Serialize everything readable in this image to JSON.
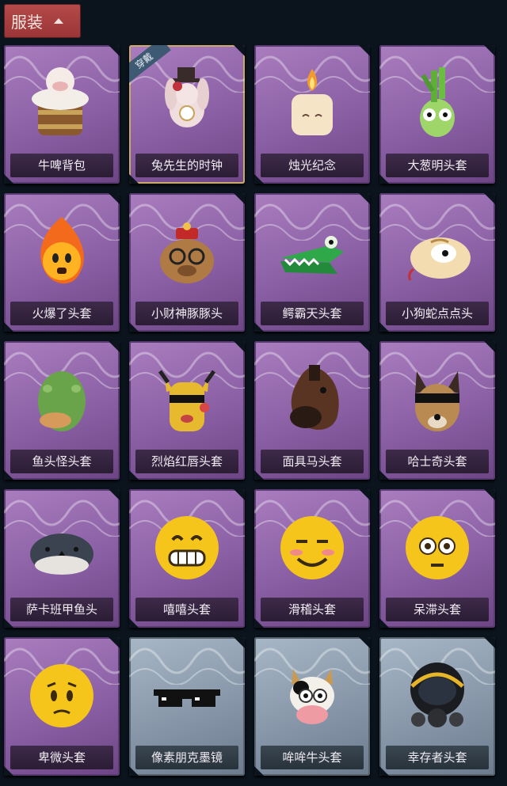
{
  "header": {
    "title": "服装"
  },
  "badge_text": "穿戴",
  "items": [
    {
      "label": "牛啤背包",
      "icon": "beer-barrel-backpack-icon",
      "theme": "purple"
    },
    {
      "label": "兔先生的时钟",
      "icon": "rabbit-clock-icon",
      "theme": "purple",
      "equipped": true
    },
    {
      "label": "烛光纪念",
      "icon": "candle-icon",
      "theme": "purple"
    },
    {
      "label": "大葱明头套",
      "icon": "scallion-head-icon",
      "theme": "purple"
    },
    {
      "label": "火爆了头套",
      "icon": "fire-head-icon",
      "theme": "purple"
    },
    {
      "label": "小财神豚豚头",
      "icon": "capybara-head-icon",
      "theme": "purple"
    },
    {
      "label": "鳄霸天头套",
      "icon": "crocodile-head-icon",
      "theme": "purple"
    },
    {
      "label": "小狗蛇点点头",
      "icon": "snake-head-icon",
      "theme": "purple"
    },
    {
      "label": "鱼头怪头套",
      "icon": "fish-head-icon",
      "theme": "purple"
    },
    {
      "label": "烈焰红唇头套",
      "icon": "yellow-mask-icon",
      "theme": "purple"
    },
    {
      "label": "面具马头套",
      "icon": "horse-head-icon",
      "theme": "purple"
    },
    {
      "label": "哈士奇头套",
      "icon": "husky-head-icon",
      "theme": "purple"
    },
    {
      "label": "萨卡班甲鱼头",
      "icon": "fish-hat-icon",
      "theme": "purple"
    },
    {
      "label": "嘻嘻头套",
      "icon": "grin-emoji-icon",
      "theme": "purple"
    },
    {
      "label": "滑稽头套",
      "icon": "smirk-emoji-icon",
      "theme": "purple"
    },
    {
      "label": "呆滞头套",
      "icon": "dazed-emoji-icon",
      "theme": "purple"
    },
    {
      "label": "卑微头套",
      "icon": "humble-emoji-icon",
      "theme": "purple"
    },
    {
      "label": "像素朋克墨镜",
      "icon": "pixel-sunglasses-icon",
      "theme": "grey"
    },
    {
      "label": "哞哞牛头套",
      "icon": "cow-head-icon",
      "theme": "grey"
    },
    {
      "label": "幸存者头套",
      "icon": "gas-mask-helmet-icon",
      "theme": "grey"
    }
  ]
}
